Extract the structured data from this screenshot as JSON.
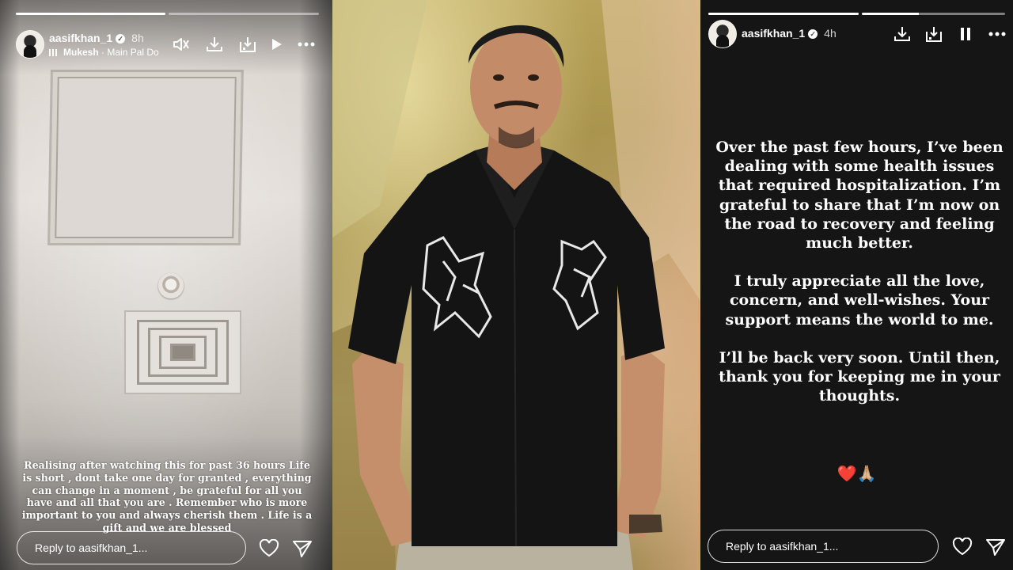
{
  "left_story": {
    "username": "aasifkhan_1",
    "age": "8h",
    "music_artist": "Mukesh",
    "music_separator": " · ",
    "music_track": "Main Pal Do",
    "progress": [
      1.0,
      0.0
    ],
    "caption": "Realising after watching this for past 36 hours Life is short , dont take one day for granted , everything can change in a moment , be grateful for all you have and all that you are . Remember who is more important to you and always cherish them . Life is a gift and we are blessed",
    "reply_placeholder": "Reply to aasifkhan_1...",
    "icons": [
      "mute-icon",
      "download-icon",
      "save-icon",
      "play-icon",
      "more-icon",
      "heart-icon",
      "send-icon"
    ]
  },
  "right_story": {
    "username": "aasifkhan_1",
    "age": "4h",
    "progress": [
      1.0,
      0.4
    ],
    "paragraphs": [
      "Over the past few hours, I’ve been dealing with some health issues that required hospitalization. I’m grateful to share that I’m now on the road to recovery and feeling much better.",
      "I truly appreciate all the love, concern, and well-wishes. Your support means the world to me.",
      "I’ll be back very soon. Until then, thank you for keeping me in your thoughts."
    ],
    "emojis": "❤️🙏🏼",
    "reply_placeholder": "Reply to aasifkhan_1...",
    "icons": [
      "download-icon",
      "save-icon",
      "pause-icon",
      "more-icon",
      "heart-icon",
      "send-icon"
    ]
  },
  "colors": {
    "right_bg": "#151515",
    "shirt": "#141414",
    "backdrop": "#b9a35a"
  }
}
